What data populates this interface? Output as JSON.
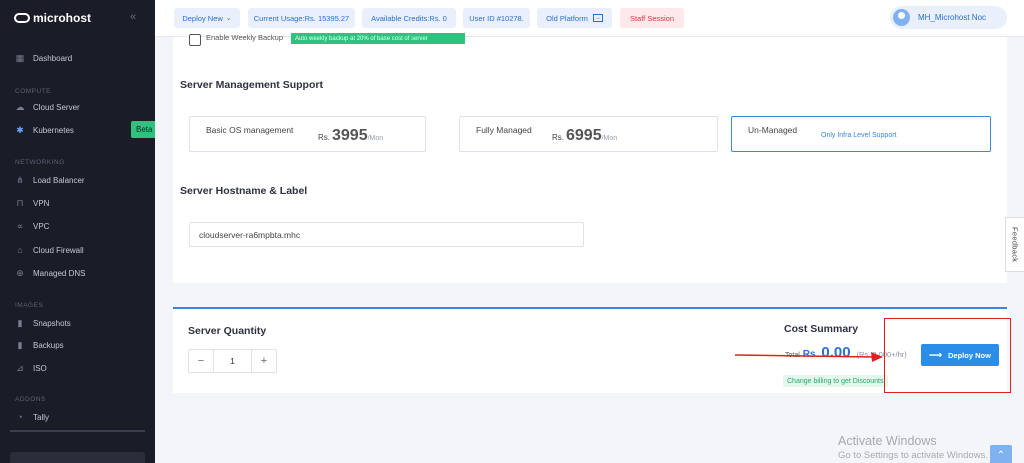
{
  "brand": {
    "name": "microhost"
  },
  "sidebar": {
    "sections": [
      "COMPUTE",
      "NETWORKING",
      "IMAGES",
      "ADDONS"
    ],
    "items": [
      {
        "label": "Dashboard",
        "icon": "dashboard-icon"
      },
      {
        "label": "Cloud Server",
        "icon": "cloud-icon"
      },
      {
        "label": "Kubernetes",
        "icon": "kubernetes-icon",
        "badge": "Beta"
      },
      {
        "label": "Load Balancer",
        "icon": "load-balancer-icon"
      },
      {
        "label": "VPN",
        "icon": "lock-icon"
      },
      {
        "label": "VPC",
        "icon": "share-icon"
      },
      {
        "label": "Cloud Firewall",
        "icon": "firewall-icon"
      },
      {
        "label": "Managed DNS",
        "icon": "globe-icon"
      },
      {
        "label": "Snapshots",
        "icon": "snapshot-icon"
      },
      {
        "label": "Backups",
        "icon": "backup-icon"
      },
      {
        "label": "ISO",
        "icon": "iso-icon"
      },
      {
        "label": "Tally",
        "icon": "clock-icon"
      }
    ]
  },
  "topbar": {
    "deploy": "Deploy New",
    "usage": "Current Usage:Rs. 15395.27",
    "credits": "Available Credits:Rs. 0",
    "user_id": "User ID #10278.",
    "old_platform": "Old Platform",
    "staff": "Staff Session",
    "user_name": "MH_Microhost Noc"
  },
  "backup": {
    "label": "Enable Weekly Backup",
    "badge": "Auto weekly backup at 20% of base cost of server"
  },
  "management": {
    "title": "Server Management Support",
    "options": [
      {
        "name": "Basic OS management",
        "currency": "Rs.",
        "price": "3995",
        "unit": "/Mon"
      },
      {
        "name": "Fully Managed",
        "currency": "Rs.",
        "price": "6995",
        "unit": "/Mon"
      },
      {
        "name": "Un-Managed",
        "note": "Only Infra Level Support",
        "selected": true
      }
    ]
  },
  "hostname": {
    "title": "Server Hostname & Label",
    "value": "cloudserver-ra6mpbta.mhc"
  },
  "quantity": {
    "title": "Server Quantity",
    "value": "1",
    "minus": "−",
    "plus": "+"
  },
  "cost": {
    "title": "Cost Summary",
    "total_label": "Total",
    "currency": "Rs.",
    "amount": "0.00",
    "hourly": "(Rs. 0.000+/hr)",
    "discount": "Change billing to get Discounts",
    "deploy_label": "Deploy Now"
  },
  "feedback": "Feedback",
  "watermark": {
    "line1": "Activate Windows",
    "line2": "Go to Settings to activate Windows."
  },
  "colors": {
    "accent": "#2a8ee8",
    "sidebar_bg": "#1a1c28",
    "success": "#2ec27e",
    "annotation": "#e02020"
  }
}
